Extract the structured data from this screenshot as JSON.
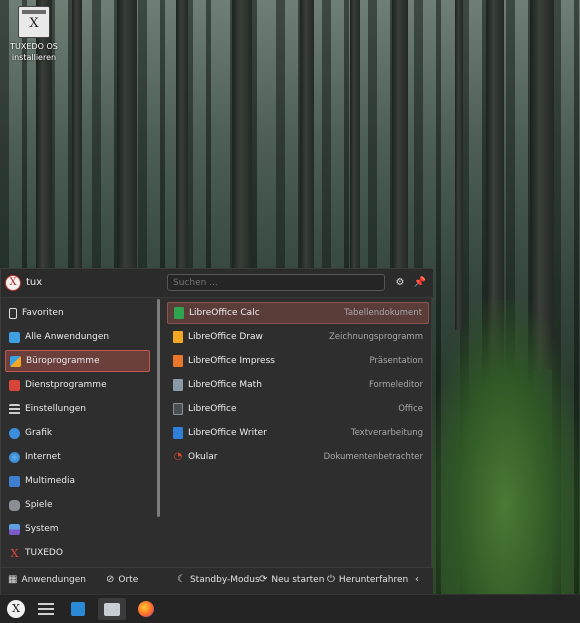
{
  "desktop": {
    "icon_label": "TUXEDO OS installieren",
    "icon_glyph": "X"
  },
  "menu": {
    "user": "tux",
    "avatar_glyph": "X",
    "search_placeholder": "Suchen ...",
    "categories": [
      {
        "label": "Favoriten",
        "icon": "bookmark-icon",
        "selected": false
      },
      {
        "label": "Alle Anwendungen",
        "icon": "grid-icon",
        "selected": false
      },
      {
        "label": "Büroprogramme",
        "icon": "office-icon",
        "selected": true
      },
      {
        "label": "Dienstprogramme",
        "icon": "toolbox-icon",
        "selected": false
      },
      {
        "label": "Einstellungen",
        "icon": "settings-icon",
        "selected": false
      },
      {
        "label": "Grafik",
        "icon": "graphics-icon",
        "selected": false
      },
      {
        "label": "Internet",
        "icon": "globe-icon",
        "selected": false
      },
      {
        "label": "Multimedia",
        "icon": "multimedia-icon",
        "selected": false
      },
      {
        "label": "Spiele",
        "icon": "gamepad-icon",
        "selected": false
      },
      {
        "label": "System",
        "icon": "system-icon",
        "selected": false
      },
      {
        "label": "TUXEDO",
        "icon": "tuxedo-icon",
        "selected": false
      }
    ],
    "apps": [
      {
        "name": "LibreOffice Calc",
        "desc": "Tabellendokument",
        "color": "#2fa44f",
        "selected": true
      },
      {
        "name": "LibreOffice Draw",
        "desc": "Zeichnungsprogramm",
        "color": "#f5a623",
        "selected": false
      },
      {
        "name": "LibreOffice Impress",
        "desc": "Präsentation",
        "color": "#e8762b",
        "selected": false
      },
      {
        "name": "LibreOffice Math",
        "desc": "Formeleditor",
        "color": "#8a9aa8",
        "selected": false
      },
      {
        "name": "LibreOffice",
        "desc": "Office",
        "color": "#4a4f55",
        "selected": false
      },
      {
        "name": "LibreOffice Writer",
        "desc": "Textverarbeitung",
        "color": "#2f7fd8",
        "selected": false
      },
      {
        "name": "Okular",
        "desc": "Dokumentenbetrachter",
        "color": "#d9452f",
        "selected": false
      }
    ],
    "footer": {
      "applications": "Anwendungen",
      "places": "Orte",
      "standby": "Standby-Modus",
      "restart": "Neu starten",
      "shutdown": "Herunterfahren"
    }
  },
  "taskbar": {
    "launcher_glyph": "X",
    "items": [
      "app-launcher",
      "task-manager",
      "discover-store",
      "file-manager",
      "firefox"
    ]
  },
  "colors": {
    "accent": "#c0574f",
    "menu_bg": "#2d2e2d",
    "taskbar_bg": "#232423"
  }
}
